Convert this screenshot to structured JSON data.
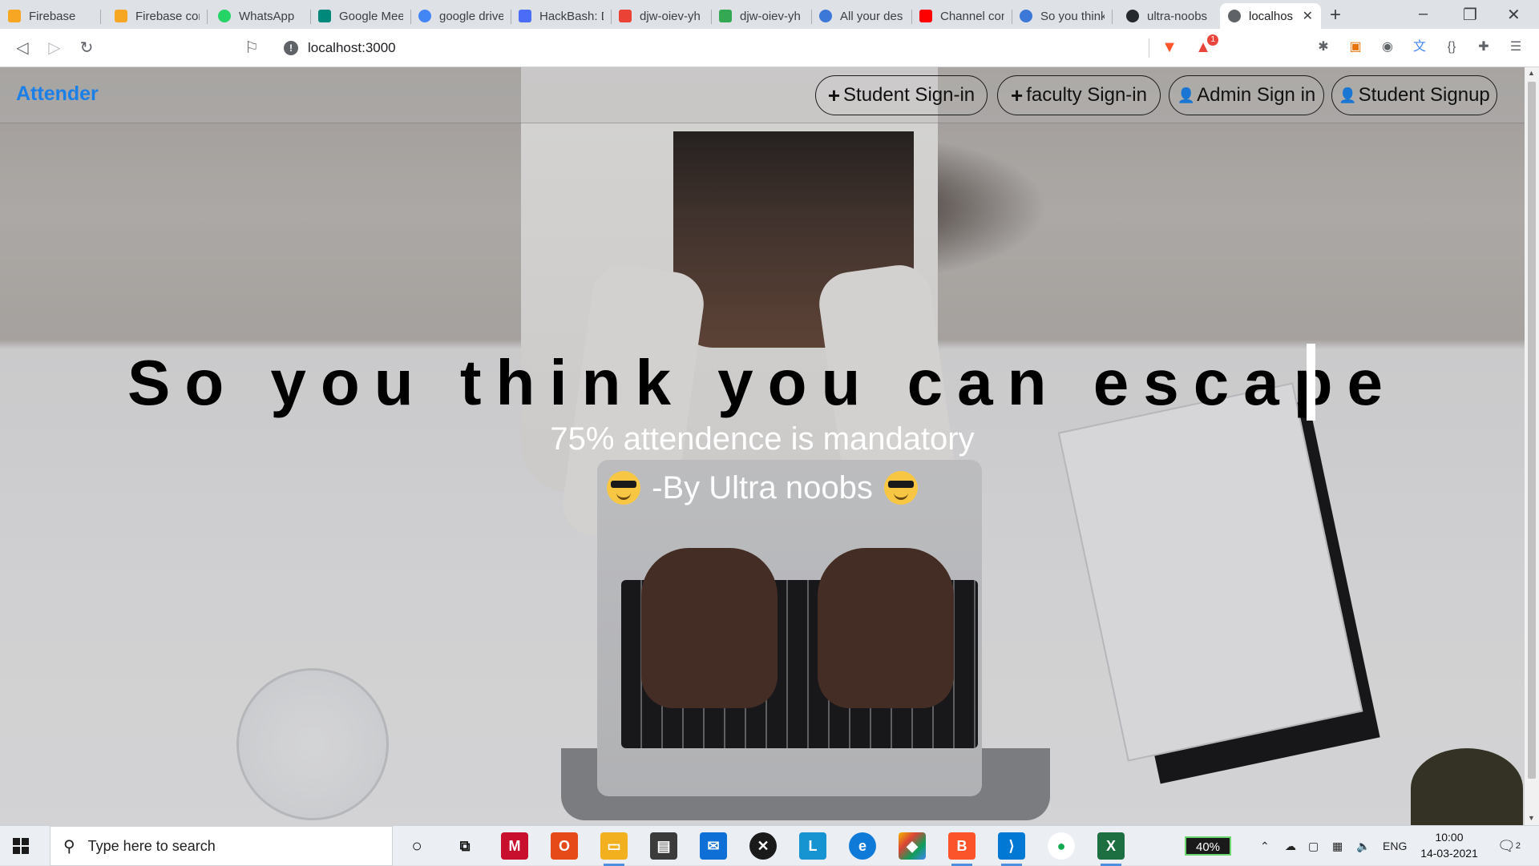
{
  "browser": {
    "tabs": [
      {
        "title": "Firebase",
        "color": "#f6a623"
      },
      {
        "title": "Firebase cor",
        "color": "#f6a623"
      },
      {
        "title": "WhatsApp",
        "color": "#25d366"
      },
      {
        "title": "Google Mee",
        "color": "#00897b"
      },
      {
        "title": "google drive",
        "color": "#4285f4"
      },
      {
        "title": "HackBash: D",
        "color": "#4a6cf7"
      },
      {
        "title": "djw-oiev-yh",
        "color": "#ea4335"
      },
      {
        "title": "djw-oiev-yh",
        "color": "#34a853"
      },
      {
        "title": "All your des",
        "color": "#3c78d8"
      },
      {
        "title": "Channel con",
        "color": "#ff0000"
      },
      {
        "title": "So you think",
        "color": "#3c78d8"
      },
      {
        "title": "ultra-noobs",
        "color": "#24292e"
      },
      {
        "title": "localhos",
        "color": "#5f6368",
        "active": true
      }
    ],
    "new_tab_label": "+",
    "close_tab_label": "✕",
    "url": "localhost:3000",
    "rewards_badge": "1"
  },
  "app": {
    "brand": "Attender",
    "nav_buttons": [
      {
        "label": "Student Sign-in",
        "icon": "plus-icon"
      },
      {
        "label": "faculty Sign-in",
        "icon": "plus-icon"
      },
      {
        "label": "Admin Sign in",
        "icon": "person-icon"
      },
      {
        "label": "Student Signup",
        "icon": "person-icon"
      }
    ],
    "hero_title": "So you think you can escape",
    "hero_subtitle": "75% attendence is mandatory",
    "hero_byline": "-By Ultra noobs",
    "accent_color": "#1b7fe8"
  },
  "taskbar": {
    "search_placeholder": "Type here to search",
    "battery": "40%",
    "language": "ENG",
    "time": "10:00",
    "date": "14-03-2021",
    "notification_count": "2"
  }
}
